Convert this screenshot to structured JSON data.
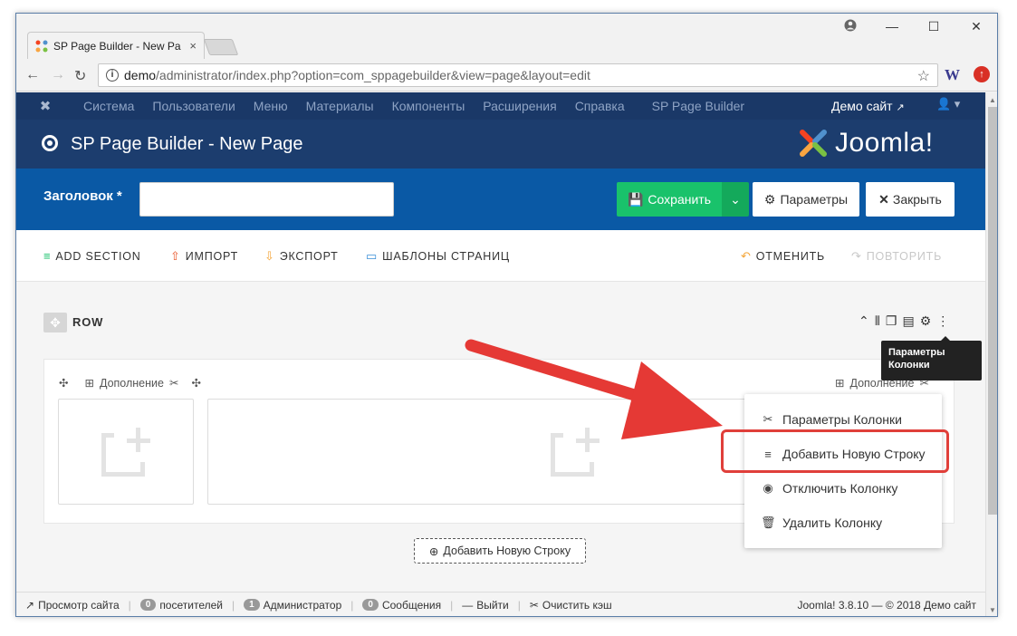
{
  "browser": {
    "tab_title": "SP Page Builder - New Pa",
    "tab_close": "×",
    "url_host": "demo",
    "url_rest": "/administrator/index.php?option=com_sppagebuilder&view=page&layout=edit",
    "ext_w": "W"
  },
  "topnav": {
    "items": [
      "Система",
      "Пользователи",
      "Меню",
      "Материалы",
      "Компоненты",
      "Расширения",
      "Справка"
    ],
    "spb": "SP Page Builder",
    "site": "Демо сайт"
  },
  "header": {
    "title": "SP Page Builder - New Page",
    "logo_word": "Joomla!"
  },
  "toolbar": {
    "title_label": "Заголовок *",
    "title_value": "",
    "save": "Сохранить",
    "params": "Параметры",
    "close": "Закрыть"
  },
  "actions": {
    "add_section": "ADD SECTION",
    "import": "ИМПОРТ",
    "export": "ЭКСПОРТ",
    "templates": "ШАБЛОНЫ СТРАНИЦ",
    "undo": "ОТМЕНИТЬ",
    "redo": "ПОВТОРИТЬ"
  },
  "row": {
    "label": "ROW",
    "col1_label": "Дополнение",
    "col2_label": "Дополнение",
    "add_row": "Добавить Новую Строку"
  },
  "tooltip": {
    "line1": "Параметры",
    "line2": "Колонки"
  },
  "menu": {
    "items": [
      "Параметры Колонки",
      "Добавить Новую Строку",
      "Отключить Колонку",
      "Удалить Колонку"
    ]
  },
  "statusbar": {
    "preview": "Просмотр сайта",
    "visitors_count": "0",
    "visitors": "посетителей",
    "admins_count": "1",
    "admins": "Администратор",
    "messages_count": "0",
    "messages": "Сообщения",
    "logout": "Выйти",
    "cache": "Очистить кэш",
    "version": "Joomla! 3.8.10 — © 2018 Демо сайт"
  },
  "colors": {
    "topnav": "#1a3867",
    "header": "#1c3d6e",
    "toolbar": "#0a59a5",
    "save": "#19c26b",
    "highlight": "#e03f3a"
  }
}
